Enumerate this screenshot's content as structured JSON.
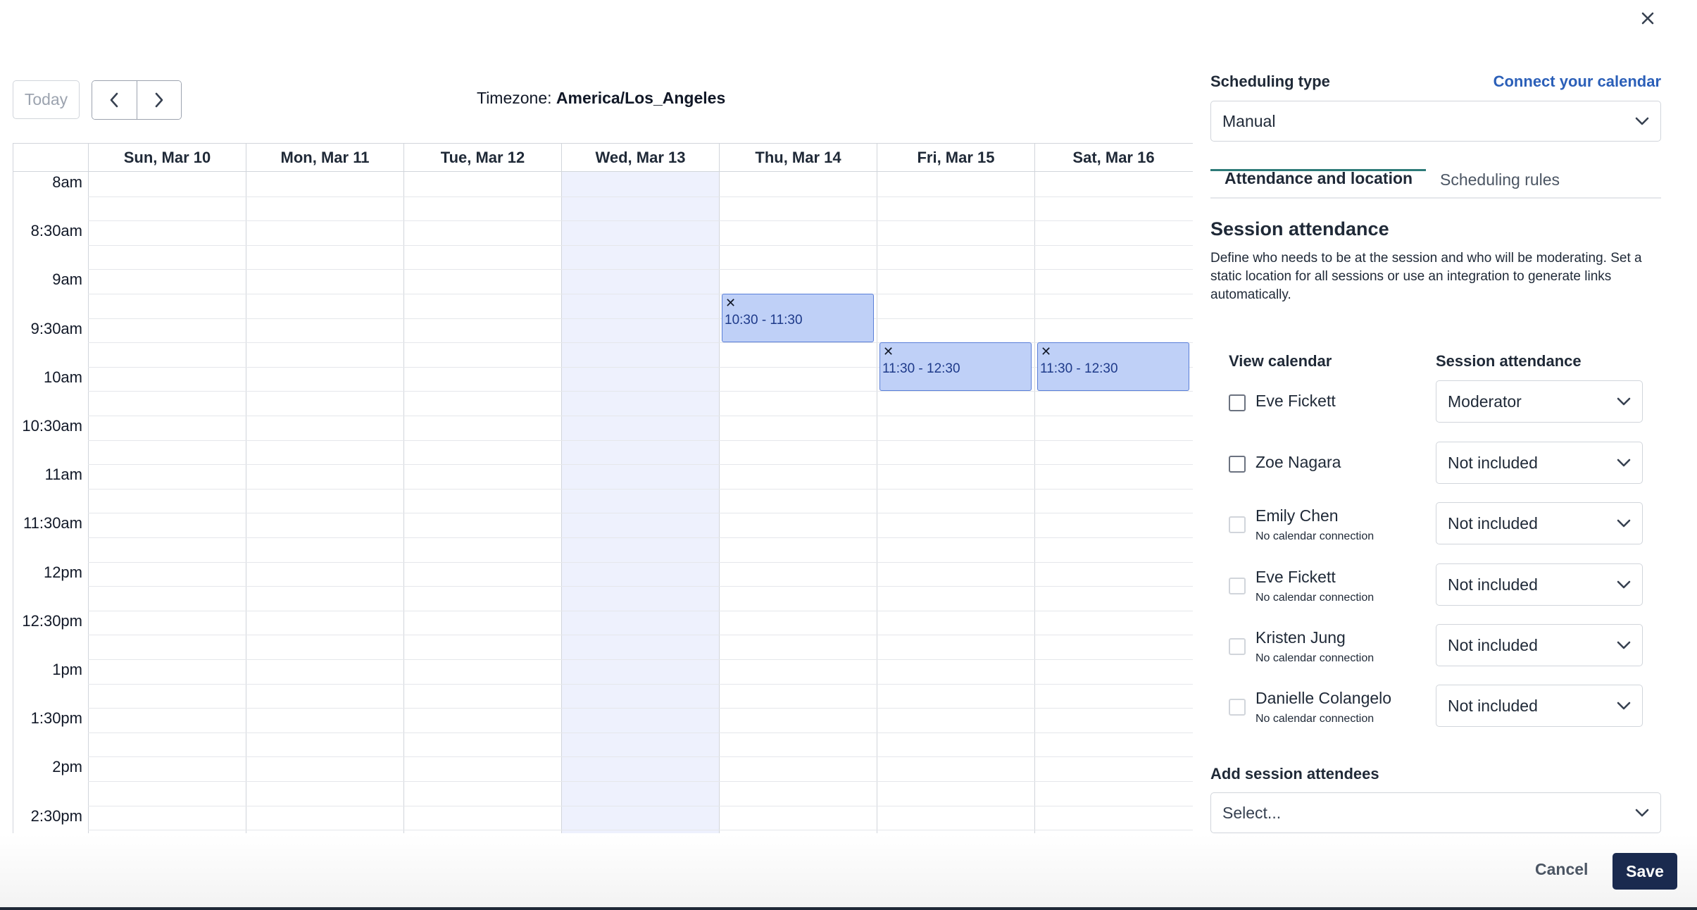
{
  "toolbar": {
    "today_label": "Today",
    "timezone_label": "Timezone:",
    "timezone_value": "America/Los_Angeles"
  },
  "calendar": {
    "days": [
      "Sun, Mar 10",
      "Mon, Mar 11",
      "Tue, Mar 12",
      "Wed, Mar 13",
      "Thu, Mar 14",
      "Fri, Mar 15",
      "Sat, Mar 16"
    ],
    "highlighted_day": "Wed, Mar 13",
    "times": [
      "8am",
      "8:30am",
      "9am",
      "9:30am",
      "10am",
      "10:30am",
      "11am",
      "11:30am",
      "12pm",
      "12:30pm",
      "1pm",
      "1:30pm",
      "2pm",
      "2:30pm"
    ],
    "events": [
      {
        "day": "Thu, Mar 14",
        "start": "10:30",
        "end": "11:30",
        "label": "10:30 - 11:30",
        "remove_glyph": "✕"
      },
      {
        "day": "Fri, Mar 15",
        "start": "11:30",
        "end": "12:30",
        "label": "11:30 - 12:30",
        "remove_glyph": "✕"
      },
      {
        "day": "Sat, Mar 16",
        "start": "11:30",
        "end": "12:30",
        "label": "11:30 - 12:30",
        "remove_glyph": "✕"
      }
    ],
    "event_color": "#bfd0f7",
    "today_column_color": "#eef1fd"
  },
  "panel": {
    "scheduling_type_label": "Scheduling type",
    "connect_calendar_link": "Connect your calendar",
    "scheduling_type_value": "Manual",
    "tabs": [
      {
        "label": "Attendance and location",
        "active": true
      },
      {
        "label": "Scheduling rules",
        "active": false
      }
    ],
    "section_title": "Session attendance",
    "section_description": "Define who needs to be at the session and who will be moderating. Set a static location for all sessions or use an integration to generate links automatically.",
    "col_view_calendar": "View calendar",
    "col_session_attendance": "Session attendance",
    "attendees": [
      {
        "name": "Eve Fickett",
        "sub": "",
        "role": "Moderator",
        "checkbox_enabled": true
      },
      {
        "name": "Zoe Nagara",
        "sub": "",
        "role": "Not included",
        "checkbox_enabled": true
      },
      {
        "name": "Emily Chen",
        "sub": "No calendar connection",
        "role": "Not included",
        "checkbox_enabled": false
      },
      {
        "name": "Eve Fickett",
        "sub": "No calendar connection",
        "role": "Not included",
        "checkbox_enabled": false
      },
      {
        "name": "Kristen Jung",
        "sub": "No calendar connection",
        "role": "Not included",
        "checkbox_enabled": false
      },
      {
        "name": "Danielle Colangelo",
        "sub": "No calendar connection",
        "role": "Not included",
        "checkbox_enabled": false
      }
    ],
    "add_attendees_label": "Add session attendees",
    "add_attendees_placeholder": "Select..."
  },
  "footer": {
    "cancel_label": "Cancel",
    "save_label": "Save"
  },
  "colors": {
    "accent_link": "#2b5fb8",
    "save_bg": "#1a2a4f",
    "tab_underline": "#2d7a78"
  },
  "icons": {
    "close": "close-icon",
    "prev": "chevron-left-icon",
    "next": "chevron-right-icon",
    "dropdown": "chevron-down-icon"
  }
}
